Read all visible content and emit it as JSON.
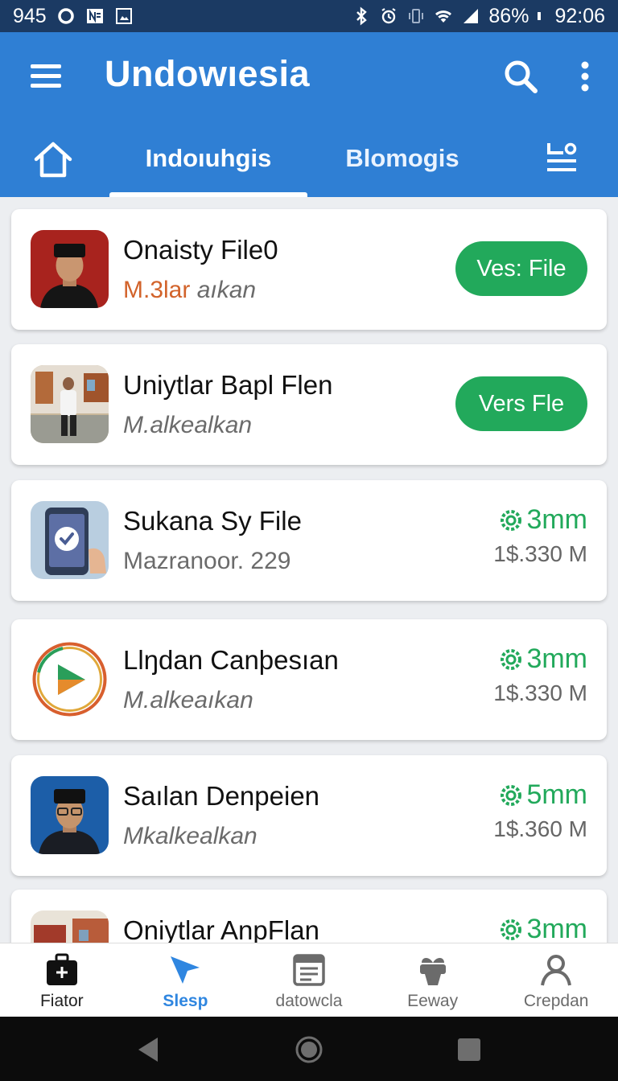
{
  "status_bar": {
    "left_text": "945",
    "battery": "86%",
    "time": "92:06"
  },
  "app_bar": {
    "title": "Undowıesia",
    "icons": {
      "menu": "hamburger-menu-icon",
      "search": "search-icon",
      "more": "more-vert-icon"
    },
    "tabs": [
      {
        "label": "Indoıuhgis",
        "active": true
      },
      {
        "label": "Blomogis",
        "active": false
      }
    ]
  },
  "list": {
    "items": [
      {
        "title": "Onaisty File0",
        "subtitle_accent": "M.3lar",
        "subtitle_rest": " aıkan",
        "action_label": "Ves: File"
      },
      {
        "title": "Uniytlar Bapl Flen",
        "subtitle": "M.alkealkan",
        "action_label": "Vers Fle"
      },
      {
        "title": "Sukana Sy File",
        "subtitle": "Mazranoor. 229",
        "size": "3mm",
        "price": "1$.330 M"
      },
      {
        "title": "Llŋdan Canþesıan",
        "subtitle": "M.alkeaıkan",
        "size": "3mm",
        "price": "1$.330 M"
      },
      {
        "title": "Saılan Denpeien",
        "subtitle": "Mkalkealkan",
        "size": "5mm",
        "price": "1$.360 M"
      },
      {
        "title": "Oniytlar AnpFlan",
        "size": "3mm"
      }
    ]
  },
  "bottom_nav": {
    "items": [
      {
        "label": "Fiator",
        "icon": "briefcase-icon"
      },
      {
        "label": "Slesp",
        "icon": "send-icon",
        "active": true
      },
      {
        "label": "datowcla",
        "icon": "document-icon"
      },
      {
        "label": "Eeway",
        "icon": "gift-icon"
      },
      {
        "label": "Crepdan",
        "icon": "person-icon"
      }
    ]
  },
  "colors": {
    "status_bar": "#1b3a63",
    "app_bar": "#2f7fd4",
    "accent_green": "#22a95b",
    "active_nav": "#2f86e0",
    "subtitle_accent": "#d2632b"
  }
}
